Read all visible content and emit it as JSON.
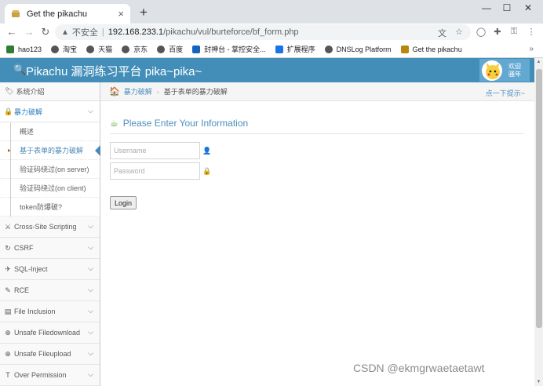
{
  "browser": {
    "tab_title": "Get the pikachu",
    "tab_close": "×",
    "new_tab": "+",
    "win_controls": [
      "—",
      "☐",
      "✕"
    ],
    "nav": {
      "back": "←",
      "forward": "→",
      "reload": "↻"
    },
    "omnibox": {
      "warning": "▲",
      "insecure_label": "不安全",
      "separator": "|",
      "host": "192.168.233.1",
      "path": "/pikachu/vul/burteforce/bf_form.php"
    },
    "toolbar_icons": [
      "translate-icon",
      "star-icon",
      "extension-circle-icon",
      "puzzle-icon",
      "key-icon",
      "menu-icon"
    ],
    "bookmarks": [
      {
        "label": "hao123",
        "color": "#2e7d32"
      },
      {
        "label": "淘宝",
        "color": "#555555"
      },
      {
        "label": "天猫",
        "color": "#555555"
      },
      {
        "label": "京东",
        "color": "#555555"
      },
      {
        "label": "百度",
        "color": "#555555"
      },
      {
        "label": "封神台 - 掌控安全...",
        "color": "#1565c0"
      },
      {
        "label": "扩展程序",
        "color": "#1a73e8"
      },
      {
        "label": "DNSLog Platform",
        "color": "#555555"
      },
      {
        "label": "Get the pikachu",
        "color": "#b8860b"
      }
    ],
    "bookmarks_more": "»"
  },
  "header": {
    "title": "Pikachu 漏洞练习平台 pika~pika~",
    "welcome_line1": "欢迎",
    "welcome_line2": "骚年"
  },
  "sidebar": {
    "top_item": "系统介绍",
    "active_section": "暴力破解",
    "sub_items": [
      "概述",
      "基于表单的暴力破解",
      "验证码绕过(on server)",
      "验证码绕过(on client)",
      "token防爆破?"
    ],
    "sections": [
      {
        "label": "Cross-Site Scripting",
        "icon": "⚔"
      },
      {
        "label": "CSRF",
        "icon": "↻"
      },
      {
        "label": "SQL-Inject",
        "icon": "✈"
      },
      {
        "label": "RCE",
        "icon": "✎"
      },
      {
        "label": "File Inclusion",
        "icon": "▤"
      },
      {
        "label": "Unsafe Filedownload",
        "icon": "⊕"
      },
      {
        "label": "Unsafe Fileupload",
        "icon": "⊕"
      },
      {
        "label": "Over Permission",
        "icon": "T"
      }
    ]
  },
  "breadcrumb": {
    "link": "暴力破解",
    "separator": "›",
    "current": "基于表单的暴力破解",
    "hint": "点一下提示~"
  },
  "form": {
    "title": "Please Enter Your Information",
    "username_placeholder": "Username",
    "password_placeholder": "Password",
    "login_label": "Login"
  },
  "watermark": "CSDN @ekmgrwaetaetawt"
}
